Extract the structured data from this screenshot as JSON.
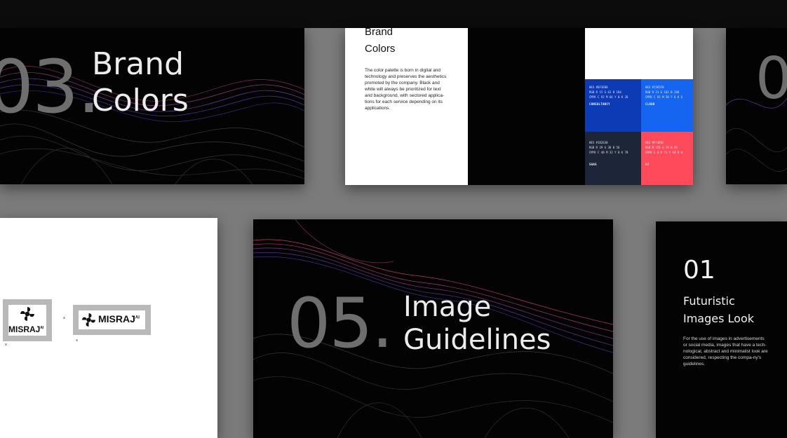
{
  "slides": {
    "brand_colors_title": {
      "number": "03.",
      "title": "Brand\nColors"
    },
    "brand_colors_detail": {
      "heading": "Brand\nColors",
      "body": "The color palette is born in digital and technology and preserves the aesthetics promoted by the company. Black and white will always be prioritized for text and background, with sectored applica-tions for each service depending on its applications.",
      "swatches": [
        {
          "name": "CONSULTANCY",
          "color": "#0c3bb5",
          "lines": [
            "HEX #0F3EB8",
            "RGB R 15  G 62  B 184",
            "CMYK C 92  M 66  Y 0  K 28"
          ]
        },
        {
          "name": "CLOUD",
          "color": "#1565f0",
          "lines": [
            "HEX #1565F0",
            "RGB R 21  G 101  B 240",
            "CMYK C 91  M 58  Y 0  K 6"
          ]
        },
        {
          "name": "SAAS",
          "color": "#1d2638",
          "lines": [
            "HEX #1D2638",
            "RGB R 29  G 38  B 56",
            "CMYK C 48  M 32  Y 0  K 78"
          ]
        },
        {
          "name": "AI",
          "color": "#ff4a5c",
          "lines": [
            "HEX #FF4A5C",
            "RGB R 255  G 74  B 92",
            "CMYK C 0  M 71  Y 64  K 0"
          ]
        }
      ]
    },
    "partial_next": {
      "number": "0"
    },
    "logo_clearspace": {
      "logo_text": "MISRAJ",
      "logo_suffix": "AI",
      "measure_mark": "x"
    },
    "image_guidelines_title": {
      "number": "05.",
      "title": "Image\nGuidelines"
    },
    "futuristic_images": {
      "number": "01",
      "title": "Futuristic\nImages Look",
      "body": "For the use of images in advertisements or social media, images that have a tech-nological, abstract and minimalist look are considered, respecting the compa-ny's guidelines."
    }
  },
  "colors": {
    "background": "#7b7b7b",
    "slide_dark": "#030303",
    "wave_pink": "#e2457a",
    "wave_purple": "#7b4bd6",
    "wave_grey": "#5a5a5a"
  }
}
